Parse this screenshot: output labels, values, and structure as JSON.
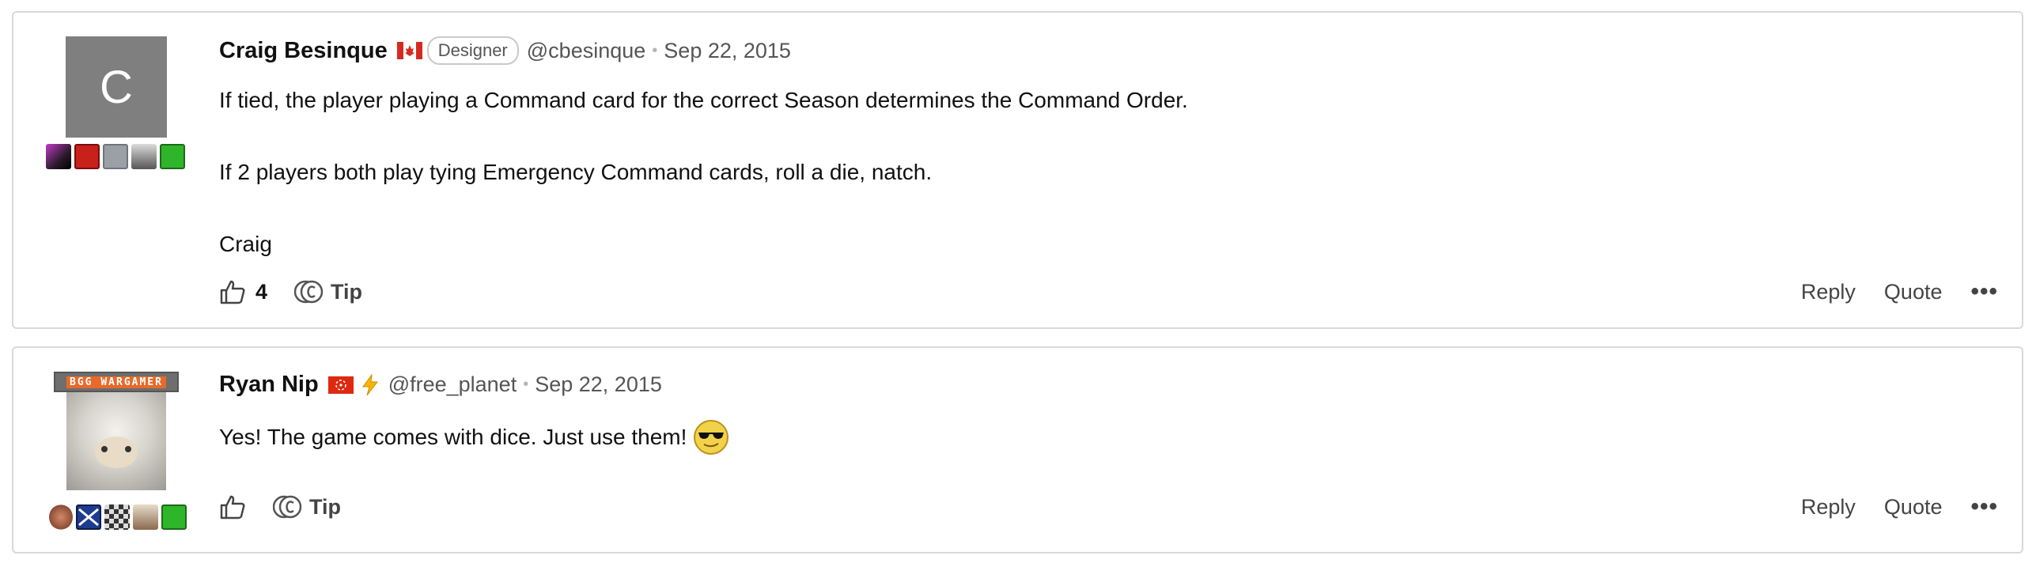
{
  "posts": [
    {
      "author": "Craig Besinque",
      "avatar_letter": "C",
      "role_badge": "Designer",
      "handle": "@cbesinque",
      "separator": "•",
      "date": "Sep 22, 2015",
      "body": [
        "If tied, the player playing a Command card for the correct Season determines the Command Order.",
        "If 2 players both play tying Emergency Command cards, roll a die, natch.",
        "Craig"
      ],
      "likes": "4",
      "tip_label": "Tip",
      "reply_label": "Reply",
      "quote_label": "Quote",
      "more_label": "•••"
    },
    {
      "author": "Ryan Nip",
      "avatar_banner": "BGG WARGAMER",
      "handle": "@free_planet",
      "separator": "•",
      "date": "Sep 22, 2015",
      "body": [
        "Yes! The game comes with dice. Just use them!"
      ],
      "tip_label": "Tip",
      "reply_label": "Reply",
      "quote_label": "Quote",
      "more_label": "•••"
    }
  ],
  "icons": {
    "flag_canada": "canada-flag-icon",
    "flag_hong_kong": "hong-kong-flag-icon",
    "lightning": "lightning-icon",
    "thumbs_up": "thumbs-up-icon",
    "tip_coin": "tip-coin-icon",
    "sunglasses_emoji": "sunglasses-emoji-icon"
  },
  "colors": {
    "accent_orange": "#e8692a",
    "flag_red": "#d52b1e",
    "lightning_yellow": "#f5b800"
  }
}
